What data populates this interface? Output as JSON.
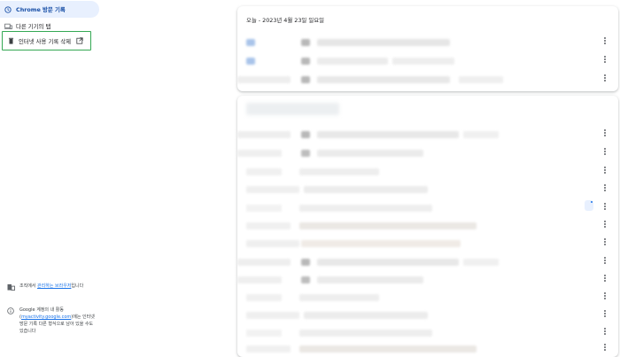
{
  "sidebar": {
    "items": [
      {
        "label": "Chrome 방문 기록",
        "icon": "history-icon"
      },
      {
        "label": "다른 기기의 탭",
        "icon": "devices-icon"
      },
      {
        "label": "인터넷 사용 기록 삭제",
        "icon": "trash-icon"
      }
    ],
    "footer": {
      "org_prefix": "조직에서 ",
      "org_link": "관리하는 브라우저",
      "org_suffix": "입니다",
      "account_prefix": "Google 계정의 내 활동(",
      "account_link": "myactivity.google.com",
      "account_suffix": ")에는 인터넷 방문 기록 다른 형식으로 남아 있을 수도 있습니다"
    }
  },
  "main": {
    "card1_title": "오늘 - 2023년 4월 23일 일요일"
  },
  "colors": {
    "accent": "#1a73e8",
    "active_bg": "#e8f0fe",
    "highlight_border": "#34a853"
  }
}
